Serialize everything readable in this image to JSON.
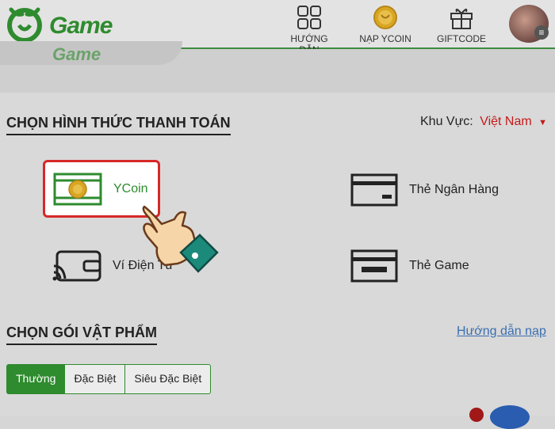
{
  "header": {
    "logo_text": "Game",
    "nav": [
      {
        "label": "HƯỚNG DẪN",
        "icon": "grid-icon"
      },
      {
        "label": "NẠP YCOIN",
        "icon": "ycoin-icon"
      },
      {
        "label": "GIFTCODE",
        "icon": "gift-icon"
      }
    ],
    "avatar_menu_glyph": "≡"
  },
  "banner": {
    "text": "Game"
  },
  "payment": {
    "title": "CHỌN HÌNH THỨC THANH TOÁN",
    "region_label": "Khu Vực:",
    "region_value": "Việt Nam",
    "region_caret": "▼",
    "methods": [
      {
        "label": "YCoin",
        "icon": "ycoin-card-icon",
        "selected": true
      },
      {
        "label": "Thẻ Ngân Hàng",
        "icon": "bank-card-icon"
      },
      {
        "label": "Ví Điện Tử",
        "icon": "wallet-icon"
      },
      {
        "label": "Thẻ Game",
        "icon": "game-card-icon"
      }
    ]
  },
  "packages": {
    "title": "CHỌN GÓI VẬT PHẨM",
    "help_link": "Hướng dẫn nạp",
    "tabs": [
      {
        "label": "Thường",
        "active": true
      },
      {
        "label": "Đặc Biệt"
      },
      {
        "label": "Siêu Đặc Biệt"
      }
    ]
  },
  "colors": {
    "brand_green": "#2e8b2e",
    "highlight_red": "#d72828",
    "link_blue": "#3a6fb0"
  }
}
